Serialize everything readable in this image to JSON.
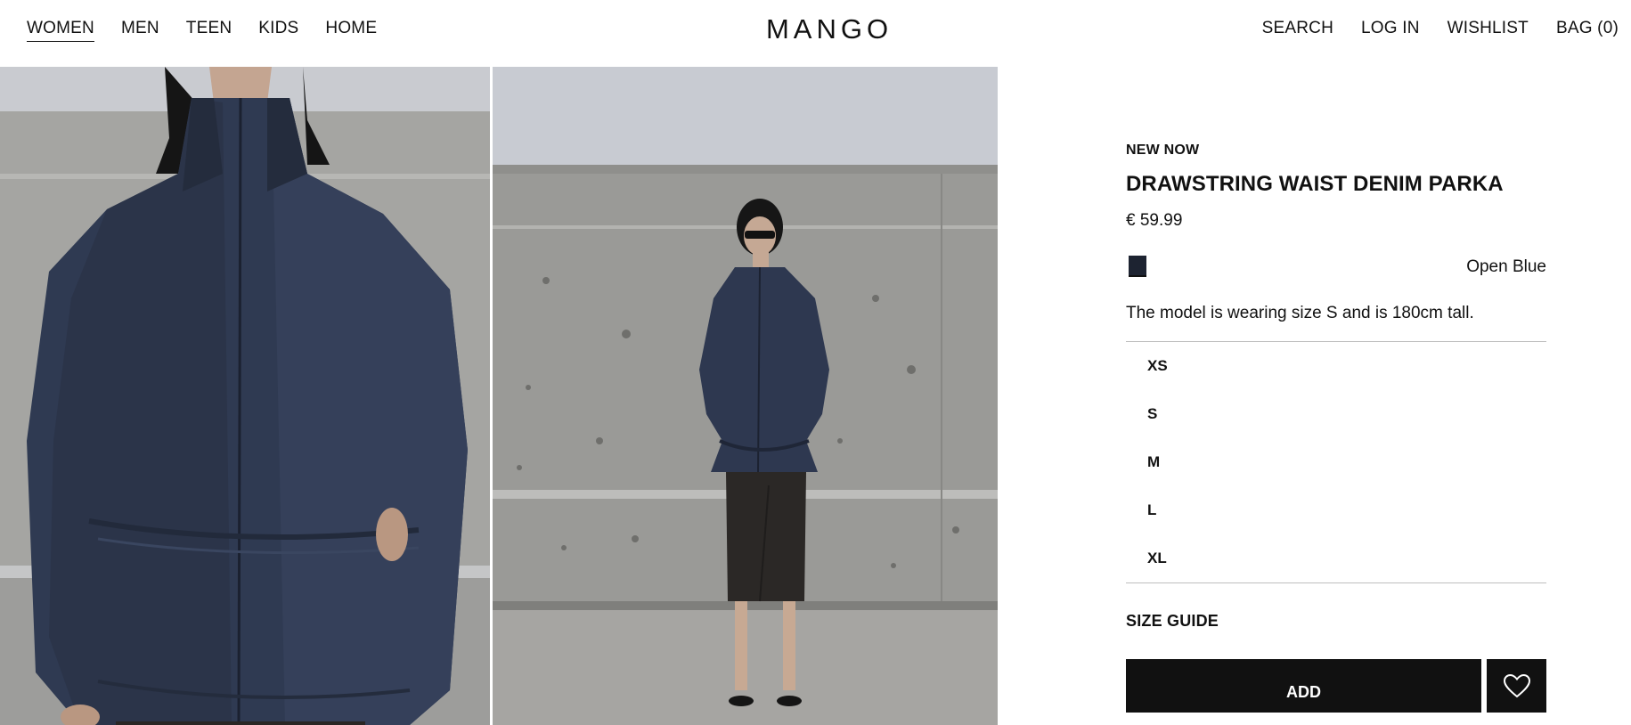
{
  "header": {
    "nav_left": [
      "WOMEN",
      "MEN",
      "TEEN",
      "KIDS",
      "HOME"
    ],
    "logo": "MANGO",
    "nav_right": [
      "SEARCH",
      "LOG IN",
      "WISHLIST",
      "BAG (0)"
    ]
  },
  "product": {
    "tag": "NEW NOW",
    "title": "DRAWSTRING WAIST DENIM PARKA",
    "price": "€ 59.99",
    "color_name": "Open Blue",
    "swatch_color": "#1d2331",
    "model_info": "The model is wearing size S and is 180cm tall.",
    "sizes": [
      "XS",
      "S",
      "M",
      "L",
      "XL"
    ],
    "size_guide": "SIZE GUIDE",
    "add_label": "ADD"
  },
  "icons": {
    "wishlist_button": "heart-icon"
  }
}
